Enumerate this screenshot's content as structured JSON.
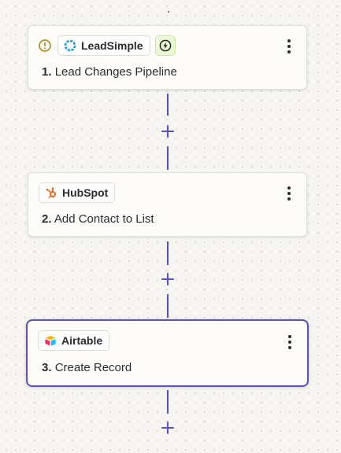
{
  "steps": [
    {
      "number": "1.",
      "title": "Lead Changes Pipeline",
      "app": "LeadSimple",
      "app_icon": "leadsimple-logo-icon",
      "has_warning": true,
      "warning_icon": "warning-icon",
      "trigger_icon": "lightning-bolt-icon",
      "menu_icon": "more-vertical-icon",
      "selected": false
    },
    {
      "number": "2.",
      "title": "Add Contact to List",
      "app": "HubSpot",
      "app_icon": "hubspot-logo-icon",
      "menu_icon": "more-vertical-icon",
      "selected": false
    },
    {
      "number": "3.",
      "title": "Create Record",
      "app": "Airtable",
      "app_icon": "airtable-logo-icon",
      "menu_icon": "more-vertical-icon",
      "selected": true
    }
  ],
  "add_step_icon": "plus-icon",
  "colors": {
    "canvas_background": "#f6f5f1",
    "connector": "#5b4fc4",
    "selected_border": "#5b4fc4",
    "warning": "#a5850f",
    "trigger_badge_bg": "#eef9d9",
    "leadsimple_brand": "#1b9fd1",
    "hubspot_brand": "#f2651c"
  }
}
